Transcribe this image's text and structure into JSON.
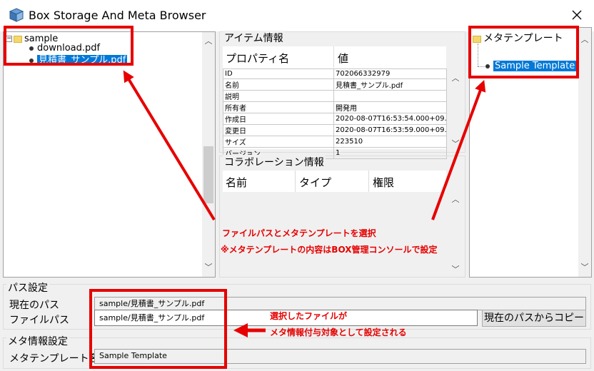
{
  "window": {
    "title": "Box Storage And Meta Browser"
  },
  "tree": {
    "root": "sample",
    "children": [
      "download.pdf",
      "見積書_サンプル.pdf"
    ]
  },
  "item_info": {
    "group_label": "アイテム情報",
    "headers": [
      "プロパティ名",
      "値"
    ],
    "rows": [
      [
        "ID",
        "702066332979"
      ],
      [
        "名前",
        "見積書_サンプル.pdf"
      ],
      [
        "説明",
        ""
      ],
      [
        "所有者",
        "開発用"
      ],
      [
        "作成日",
        "2020-08-07T16:53:54.000+09..."
      ],
      [
        "変更日",
        "2020-08-07T16:53:59.000+09..."
      ],
      [
        "サイズ",
        "223510"
      ],
      [
        "バージョン",
        "1"
      ]
    ]
  },
  "collab": {
    "group_label": "コラボレーション情報",
    "headers": [
      "名前",
      "タイプ",
      "権限"
    ]
  },
  "meta_tree": {
    "root": "メタテンプレート",
    "selected": "Sample Template"
  },
  "path_settings": {
    "group_label": "パス設定",
    "current_path_label": "現在のパス",
    "current_path_value": "sample/見積書_サンプル.pdf",
    "file_path_label": "ファイルパス",
    "file_path_value": "sample/見積書_サンプル.pdf",
    "copy_button": "現在のパスからコピー"
  },
  "meta_settings": {
    "group_label": "メタ情報設定",
    "template_label": "メタテンプレート名",
    "template_value": "Sample Template"
  },
  "annotations": {
    "center_line1": "ファイルパスとメタテンプレートを選択",
    "center_line2": "※メタテンプレートの内容はBOX管理コンソールで設定",
    "bottom_line1": "選択したファイルが",
    "bottom_line2": "メタ情報付与対象として設定される",
    "highlight_color": "#e60000"
  }
}
